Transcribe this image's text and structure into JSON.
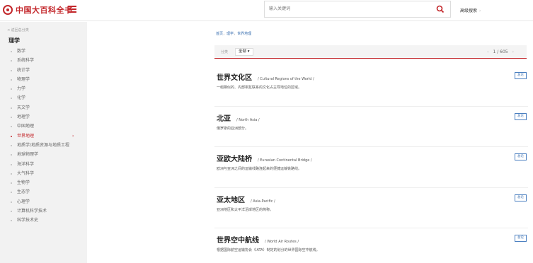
{
  "header": {
    "logo_text": "中国大百科全书",
    "search_placeholder": "输入关键词",
    "advanced_search": "高级搜索",
    "advanced_arrow": "›"
  },
  "sidebar": {
    "back": "< 返回总分类",
    "title": "理学",
    "items": [
      {
        "label": "数学"
      },
      {
        "label": "系统科学"
      },
      {
        "label": "统计学"
      },
      {
        "label": "物理学"
      },
      {
        "label": "力学"
      },
      {
        "label": "化学"
      },
      {
        "label": "天文学"
      },
      {
        "label": "地理学"
      },
      {
        "label": "中国地理"
      },
      {
        "label": "世界地理",
        "active": true
      },
      {
        "label": "地质学/地质资源与地质工程"
      },
      {
        "label": "地球物理学"
      },
      {
        "label": "海洋科学"
      },
      {
        "label": "大气科学"
      },
      {
        "label": "生物学"
      },
      {
        "label": "生态学"
      },
      {
        "label": "心理学"
      },
      {
        "label": "计算机科学技术"
      },
      {
        "label": "科学技术史"
      }
    ],
    "active_chevron": "›"
  },
  "breadcrumb": [
    "首页",
    "理学",
    "世界地理"
  ],
  "filter": {
    "label": "分类",
    "selected": "全部",
    "page_current": "1",
    "page_total": "605",
    "prev": "‹",
    "next": "›"
  },
  "entries": [
    {
      "title": "世界文化区",
      "en": "/ Cultural Regions of the World /",
      "desc": "一组相似的、内部相互联系的文化占主导地位的区域。",
      "tag": "总论"
    },
    {
      "title": "北亚",
      "en": "/ North Asia /",
      "desc": "俄罗斯的亚洲部分。",
      "tag": "总论"
    },
    {
      "title": "亚欧大陆桥",
      "en": "/ Eurasian Continental Bridge /",
      "desc": "欧洲与亚洲之间的运输线路连起来的便捷运输铁路线。",
      "tag": "总论"
    },
    {
      "title": "亚太地区",
      "en": "/ Asia-Pacific /",
      "desc": "亚洲地区和太平洋沿岸地区的简称。",
      "tag": "总论"
    },
    {
      "title": "世界空中航线",
      "en": "/ World Air Routes /",
      "desc": "根据国际航空运输协会（IATA）制定的划分的世界国际空中航线。",
      "tag": "总论"
    }
  ],
  "colors": {
    "accent": "#c3272b",
    "link": "#3a6fb0"
  }
}
